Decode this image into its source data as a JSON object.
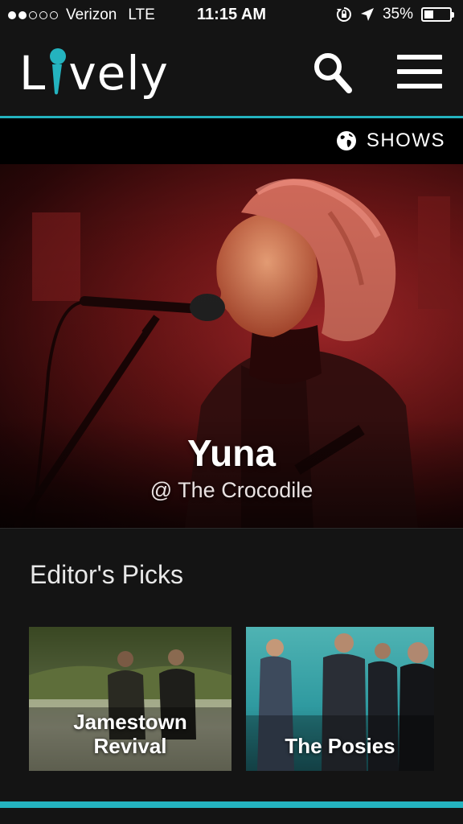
{
  "status_bar": {
    "carrier": "Verizon",
    "network": "LTE",
    "time": "11:15 AM",
    "battery_percent": "35%",
    "battery_level": 0.35,
    "signal_bars": 2,
    "signal_total": 5
  },
  "header": {
    "logo_prefix": "L",
    "logo_suffix": "vely",
    "logo_accent_color": "#24b3bf",
    "search_icon": "search-icon",
    "menu_icon": "hamburger-menu-icon"
  },
  "nav": {
    "shows_label": "SHOWS",
    "shows_icon": "globe-icon"
  },
  "featured": {
    "artist": "Yuna",
    "venue": "@ The Crocodile"
  },
  "editors_picks": {
    "title": "Editor's Picks",
    "items": [
      {
        "label_line1": "Jamestown",
        "label_line2": "Revival"
      },
      {
        "label_line1": "The Posies",
        "label_line2": ""
      }
    ]
  },
  "colors": {
    "accent": "#24b3bf",
    "background": "#141414"
  }
}
